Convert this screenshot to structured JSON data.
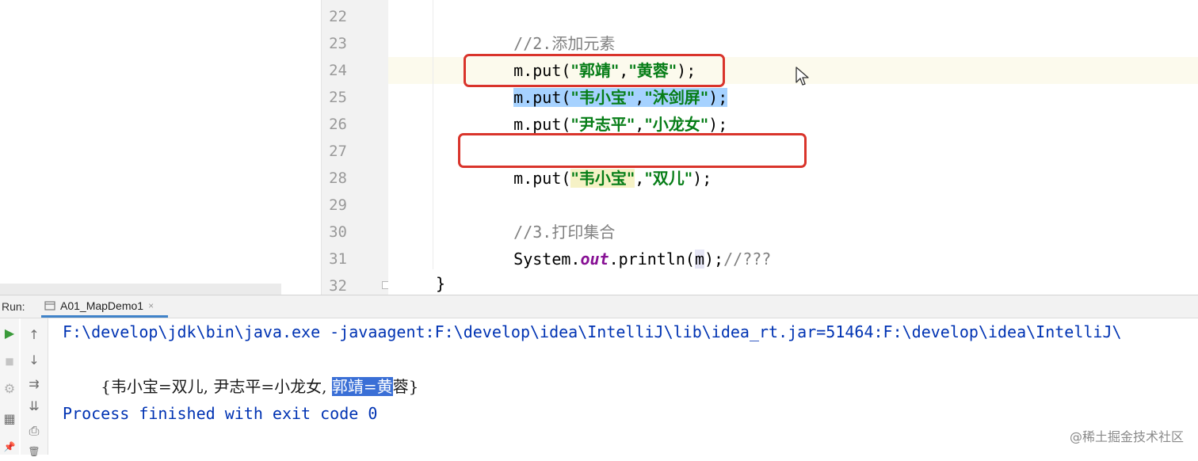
{
  "editor": {
    "line_numbers": [
      "22",
      "23",
      "24",
      "25",
      "26",
      "27",
      "28",
      "29",
      "30",
      "31",
      "32"
    ],
    "lines": {
      "l22": {
        "comment_prefix": "//2.",
        "comment_text": "添加元素"
      },
      "l23": {
        "prefix": "m.put(",
        "str1": "\"郭靖\"",
        "comma": ",",
        "str2": "\"黄蓉\"",
        "suffix": ");"
      },
      "l24": {
        "prefix": "m.put(",
        "str1": "\"韦小宝\"",
        "comma": ",",
        "str2": "\"沐剑屏\"",
        "suffix": ");"
      },
      "l25": {
        "prefix": "m.put(",
        "str1": "\"尹志平\"",
        "comma": ",",
        "str2": "\"小龙女\"",
        "suffix": ");"
      },
      "l27": {
        "prefix": "m.put(",
        "str1": "\"韦小宝\"",
        "comma": ",",
        "str2": "\"双儿\"",
        "suffix": ");"
      },
      "l29": {
        "comment_prefix": "//3.",
        "comment_text": "打印集合"
      },
      "l30": {
        "part1": "System.",
        "field": "out",
        "part2": ".println(",
        "arg": "m",
        "part3": ");",
        "comment": "//???"
      },
      "l32": {
        "brace": "}"
      }
    }
  },
  "run_panel": {
    "label": "Run:",
    "tab_title": "A01_MapDemo1",
    "tab_close": "×",
    "command_line": "F:\\develop\\jdk\\bin\\java.exe -javaagent:F:\\develop\\idea\\IntelliJ\\lib\\idea_rt.jar=51464:F:\\develop\\idea\\IntelliJ\\",
    "output": {
      "before": "{韦小宝=双儿, 尹志平=小龙女, ",
      "selected": "郭靖=黄",
      "after": "蓉}"
    },
    "exit_message": "Process finished with exit code 0"
  },
  "toolbar_icons": {
    "rerun": "▶",
    "stop": "■",
    "settings": "⚙",
    "layout": "▦",
    "pin": "📌",
    "up": "↑",
    "down": "↓",
    "wrap": "⇉",
    "scroll_end": "⇊",
    "print": "⎙",
    "trash": "🗑"
  },
  "watermark": "@稀土掘金技术社区",
  "colors": {
    "highlight_box": "#d9342b",
    "selection": "#a6d2ff",
    "string": "#067d17",
    "console_text": "#0033b3"
  }
}
